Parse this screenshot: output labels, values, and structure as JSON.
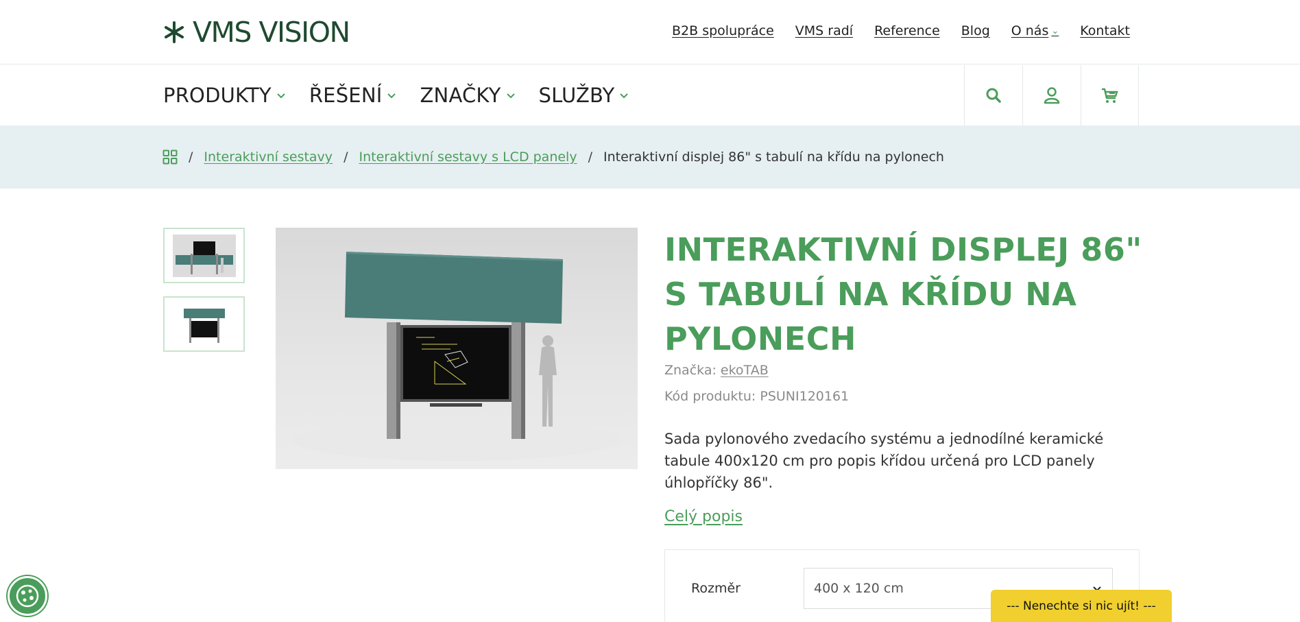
{
  "header": {
    "logo_text": "VMS VISION",
    "top_links": [
      {
        "label": "B2B spolupráce"
      },
      {
        "label": "VMS radí"
      },
      {
        "label": "Reference"
      },
      {
        "label": "Blog"
      },
      {
        "label": "O nás"
      },
      {
        "label": "Kontakt"
      }
    ],
    "menu": [
      {
        "label": "PRODUKTY"
      },
      {
        "label": "ŘEŠENÍ"
      },
      {
        "label": "ZNAČKY"
      },
      {
        "label": "SLUŽBY"
      }
    ],
    "tools": [
      "search-icon",
      "user-icon",
      "cart-icon"
    ]
  },
  "breadcrumb": {
    "items": [
      {
        "label": "Interaktivní sestavy"
      },
      {
        "label": "Interaktivní sestavy s LCD panely"
      }
    ],
    "separator": "/",
    "current": "Interaktivní displej 86\" s tabulí na křídu na pylonech"
  },
  "product": {
    "title": "INTERAKTIVNÍ DISPLEJ 86\" S TABULÍ NA KŘÍDU NA PYLONECH",
    "brand_label": "Značka:",
    "brand": "ekoTAB",
    "code_label": "Kód produktu:",
    "code": "PSUNI120161",
    "description": "Sada pylonového zvedacího systému a jednodílné keramické tabule 400x120 cm pro popis křídou určená pro LCD panely úhlopříčky 86\".",
    "full_description_link": "Celý popis",
    "options": {
      "label": "Rozměr",
      "selected": "400 x 120 cm"
    }
  },
  "promo_bar": "--- Nenechte si nic ujít! ---",
  "colors": {
    "accent_green": "#4a9d5a",
    "logo_green": "#1f4a30",
    "breadcrumb_bg": "#e6eff1",
    "board_green": "#4a7c78",
    "promo_yellow": "#f0cf2e"
  }
}
